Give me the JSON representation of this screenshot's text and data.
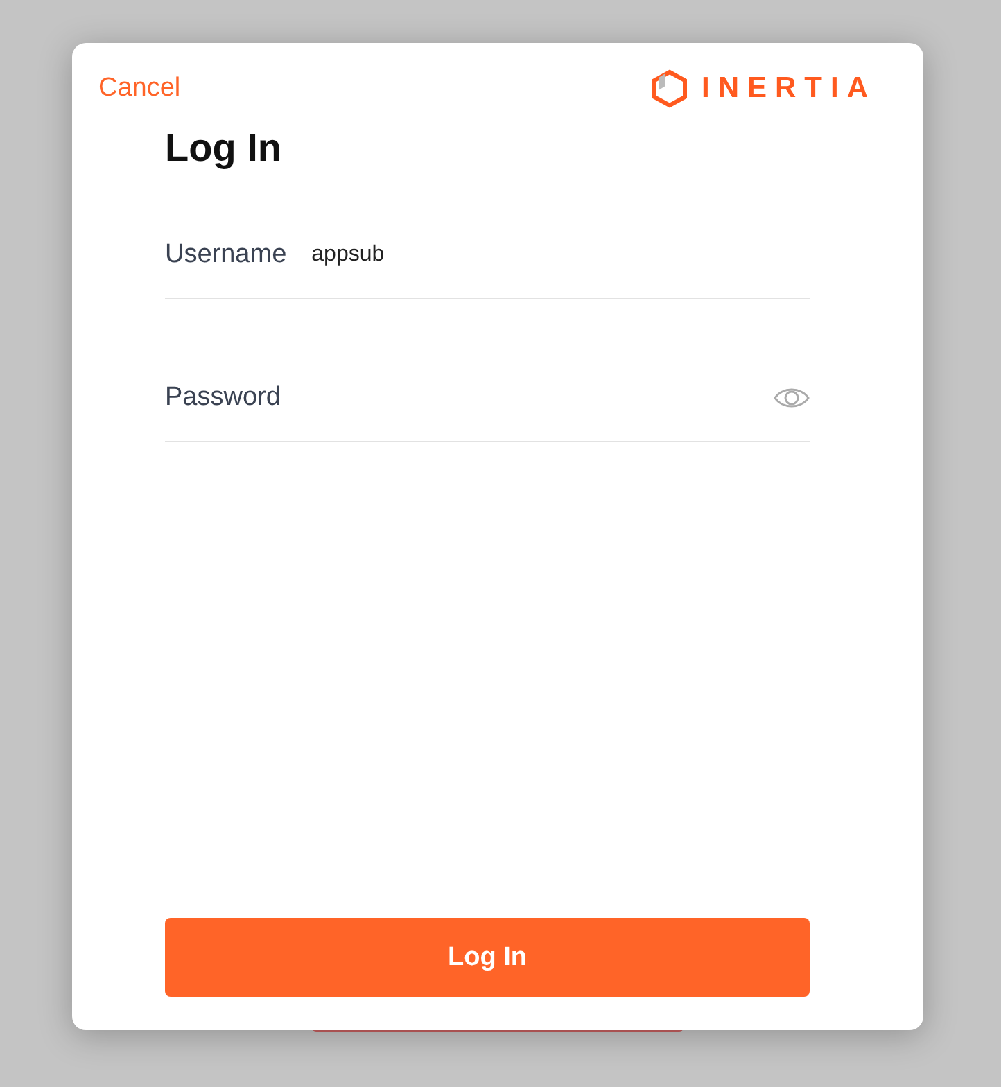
{
  "header": {
    "cancel": "Cancel",
    "logo": "INERTIA"
  },
  "title": "Log In",
  "fields": [
    {
      "kind": "text",
      "label": "Username",
      "value": "appsub"
    },
    {
      "kind": "password",
      "label": "Password"
    }
  ],
  "submit": "Log In"
}
